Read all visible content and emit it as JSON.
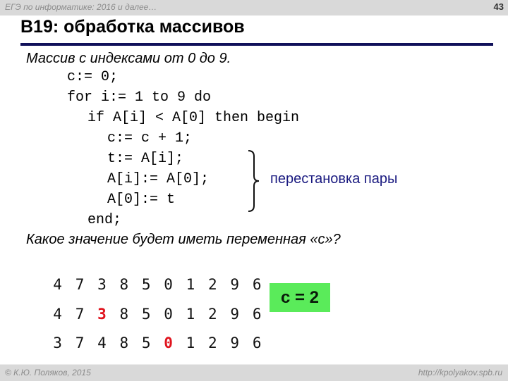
{
  "header": {
    "course": "ЕГЭ по информатике: 2016 и далее…",
    "slide_number": "43"
  },
  "title": "B19: обработка массивов",
  "intro": "Массив с индексами от 0 до 9.",
  "code_lines": [
    "c:= 0;",
    "for i:= 1 to 9 do",
    "if A[i] < A[0] then begin",
    "c:= c + 1;",
    "t:= A[i];",
    "A[i]:= A[0];",
    "A[0]:= t",
    "end;"
  ],
  "brace_note": "перестановка пары",
  "question": "Какое значение будет иметь переменная «с»?",
  "arrays": [
    {
      "values": [
        "4",
        "7",
        "3",
        "8",
        "5",
        "0",
        "1",
        "2",
        "9",
        "6"
      ],
      "highlight_index": null
    },
    {
      "values": [
        "4",
        "7",
        "3",
        "8",
        "5",
        "0",
        "1",
        "2",
        "9",
        "6"
      ],
      "highlight_index": 2
    },
    {
      "values": [
        "3",
        "7",
        "4",
        "8",
        "5",
        "0",
        "1",
        "2",
        "9",
        "6"
      ],
      "highlight_index": 5
    }
  ],
  "result": "c = 2",
  "colors": {
    "highlight": "#e0141e",
    "result_bg": "#5aeb5a",
    "rule": "#10105a",
    "note": "#1a1a80"
  },
  "footer": {
    "copyright": "© К.Ю. Поляков, 2015",
    "url": "http://kpolyakov.spb.ru"
  }
}
